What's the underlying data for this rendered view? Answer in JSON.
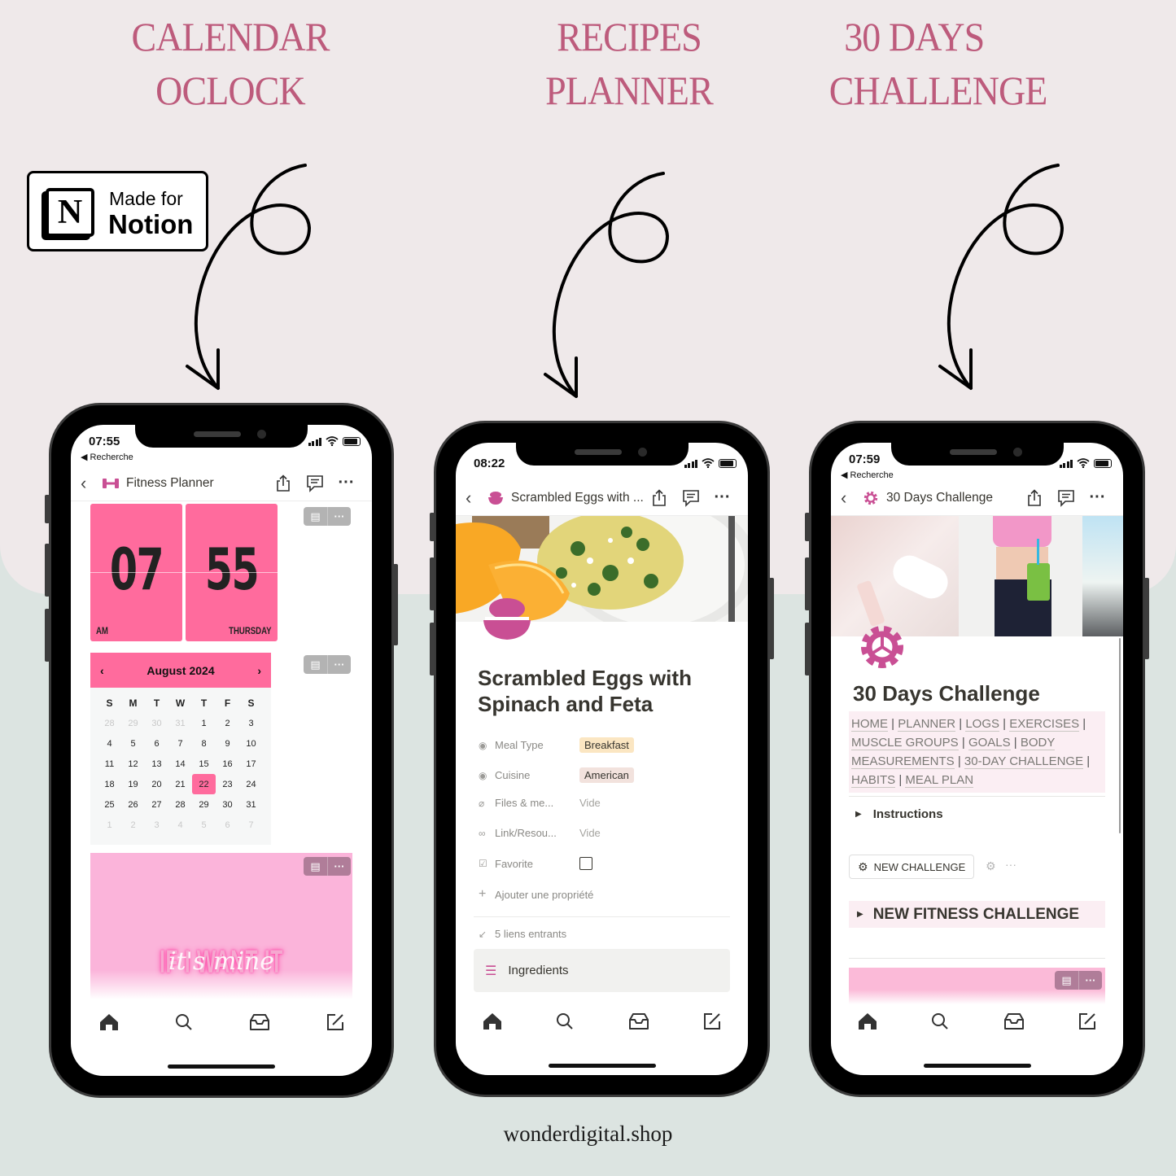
{
  "headlines": [
    {
      "line1": "CALENDAR",
      "line2": "OCLOCK"
    },
    {
      "line1": "RECIPES",
      "line2": "PLANNER"
    },
    {
      "line1": "30 DAYS",
      "line2": "CHALLENGE"
    }
  ],
  "badge": {
    "logo_letter": "N",
    "line1": "Made for",
    "line2": "Notion"
  },
  "footer": "wonderdigital.shop",
  "colors": {
    "accent_pink": "#ff6b9d",
    "headline": "#bd5b7c",
    "notion_pink": "#c94f94"
  },
  "phone1": {
    "time": "07:55",
    "back_label": "◀ Recherche",
    "page_title": "Fitness Planner",
    "page_icon": "dumbbell-icon",
    "clock": {
      "hour": "07",
      "minute": "55",
      "meridiem": "AM",
      "weekday": "THURSDAY"
    },
    "calendar": {
      "month": "August 2024",
      "prev": "‹",
      "next": "›",
      "weekdays": [
        "S",
        "M",
        "T",
        "W",
        "T",
        "F",
        "S"
      ],
      "today": "22",
      "days": [
        {
          "d": "28",
          "m": true
        },
        {
          "d": "29",
          "m": true
        },
        {
          "d": "30",
          "m": true
        },
        {
          "d": "31",
          "m": true
        },
        {
          "d": "1"
        },
        {
          "d": "2"
        },
        {
          "d": "3"
        },
        {
          "d": "4"
        },
        {
          "d": "5"
        },
        {
          "d": "6"
        },
        {
          "d": "7"
        },
        {
          "d": "8"
        },
        {
          "d": "9"
        },
        {
          "d": "10"
        },
        {
          "d": "11"
        },
        {
          "d": "12"
        },
        {
          "d": "13"
        },
        {
          "d": "14"
        },
        {
          "d": "15"
        },
        {
          "d": "16"
        },
        {
          "d": "17"
        },
        {
          "d": "18"
        },
        {
          "d": "19"
        },
        {
          "d": "20"
        },
        {
          "d": "21"
        },
        {
          "d": "22",
          "t": true
        },
        {
          "d": "23"
        },
        {
          "d": "24"
        },
        {
          "d": "25"
        },
        {
          "d": "26"
        },
        {
          "d": "27"
        },
        {
          "d": "28"
        },
        {
          "d": "29"
        },
        {
          "d": "30"
        },
        {
          "d": "31"
        },
        {
          "d": "1",
          "m": true
        },
        {
          "d": "2",
          "m": true
        },
        {
          "d": "3",
          "m": true
        },
        {
          "d": "4",
          "m": true
        },
        {
          "d": "5",
          "m": true
        },
        {
          "d": "6",
          "m": true
        },
        {
          "d": "7",
          "m": true
        }
      ]
    },
    "quote": {
      "main": "IF I WANT IT",
      "script": "it's mine"
    }
  },
  "phone2": {
    "time": "08:22",
    "page_title": "Scrambled Eggs with ...",
    "page_icon": "bowl-icon",
    "heading": "Scrambled Eggs with Spinach and Feta",
    "properties": [
      {
        "icon": "select-icon",
        "label": "Meal Type",
        "value": "Breakfast",
        "type": "tag",
        "color": "#fbe6c2"
      },
      {
        "icon": "select-icon",
        "label": "Cuisine",
        "value": "American",
        "type": "tag",
        "color": "#f2e2dd"
      },
      {
        "icon": "paperclip-icon",
        "label": "Files & me...",
        "value": "Vide",
        "type": "empty"
      },
      {
        "icon": "link-icon",
        "label": "Link/Resou...",
        "value": "Vide",
        "type": "empty"
      },
      {
        "icon": "checkbox-icon",
        "label": "Favorite",
        "value": false,
        "type": "checkbox"
      }
    ],
    "add_property": "Ajouter une propriété",
    "backlinks": "5 liens entrants",
    "ingredients_label": "Ingredients"
  },
  "phone3": {
    "time": "07:59",
    "back_label": "◀ Recherche",
    "page_title": "30 Days Challenge",
    "page_icon": "gear-icon",
    "heading": "30 Days Challenge",
    "nav_links": [
      "HOME",
      "PLANNER",
      "LOGS",
      "EXERCISES",
      "MUSCLE GROUPS",
      "GOALS",
      "BODY MEASUREMENTS",
      "30-DAY CHALLENGE",
      "HABITS",
      "MEAL PLAN"
    ],
    "instructions_toggle": "Instructions",
    "new_challenge_button": "NEW CHALLENGE",
    "fitness_toggle": "NEW FITNESS CHALLENGE"
  }
}
